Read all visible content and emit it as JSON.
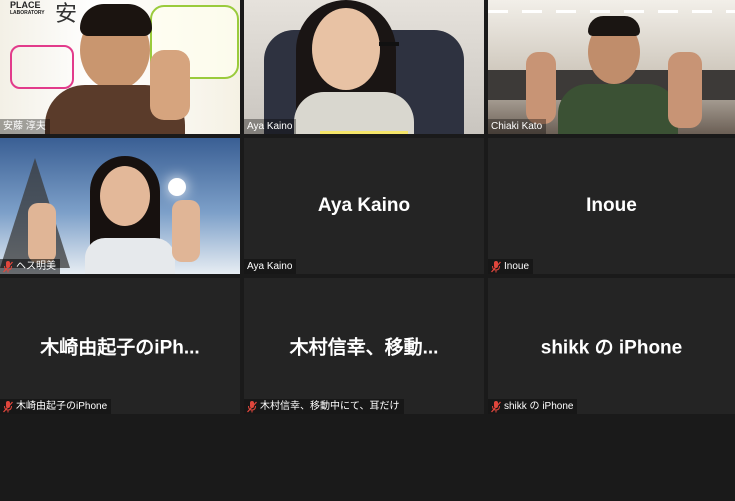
{
  "tiles": [
    {
      "kind": "video",
      "name": "安藤 淳夫",
      "muted": false,
      "scene": "whiteboard"
    },
    {
      "kind": "video",
      "name": "Aya Kaino",
      "muted": false,
      "scene": "room"
    },
    {
      "kind": "video",
      "name": "Chiaki Kato",
      "muted": false,
      "scene": "office"
    },
    {
      "kind": "video",
      "name": "ヘス明美",
      "muted": true,
      "scene": "snow"
    },
    {
      "kind": "name",
      "display": "Aya Kaino",
      "name": "Aya Kaino",
      "muted": false
    },
    {
      "kind": "name",
      "display": "Inoue",
      "name": "Inoue",
      "muted": true
    },
    {
      "kind": "name",
      "display": "木崎由起子のiPh...",
      "name": "木崎由起子のiPhone",
      "muted": true
    },
    {
      "kind": "name",
      "display": "木村信幸、移動...",
      "name": "木村信幸、移動中にて、耳だけ",
      "muted": true
    },
    {
      "kind": "name",
      "display": "shikk の iPhone",
      "name": "shikk の iPhone",
      "muted": true
    }
  ],
  "whiteboard_text": {
    "line1": "PLACE",
    "line2": "LABORATORY",
    "kanji": "安"
  },
  "colors": {
    "speaker_highlight": "#f5e56a",
    "tile_bg": "#242424",
    "muted_icon": "#e0463c"
  }
}
